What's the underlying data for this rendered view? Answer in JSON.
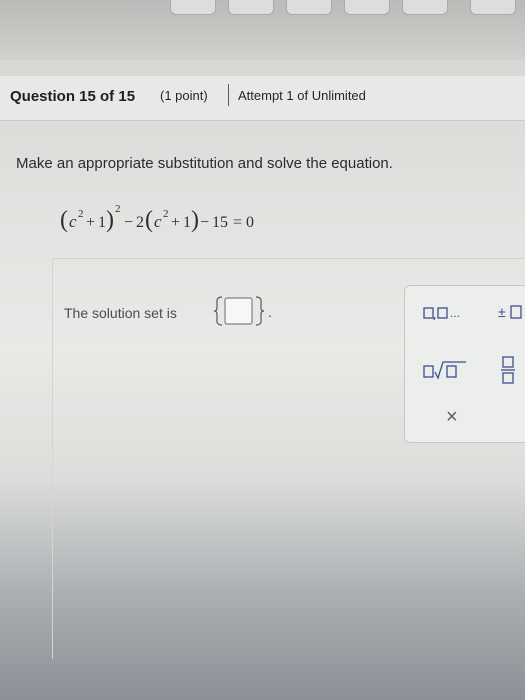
{
  "question_header": {
    "title": "Question 15 of 15",
    "points": "(1 point)",
    "attempt": "Attempt 1 of Unlimited"
  },
  "problem": {
    "instruction": "Make an appropriate substitution and solve the equation.",
    "equation": "(c^2 + 1)^2 - 2(c^2 + 1) - 15 = 0"
  },
  "answer": {
    "label": "The solution set is",
    "value": "",
    "period": "."
  },
  "math_palette": {
    "buttons": [
      {
        "name": "comma-list",
        "dots": "..."
      },
      {
        "name": "plus-minus",
        "sign": "±"
      },
      {
        "name": "nth-root"
      },
      {
        "name": "fraction"
      }
    ],
    "close_symbol": "×"
  },
  "colors": {
    "palette_icon": "#3c4f8e",
    "text": "#2a2b30"
  }
}
